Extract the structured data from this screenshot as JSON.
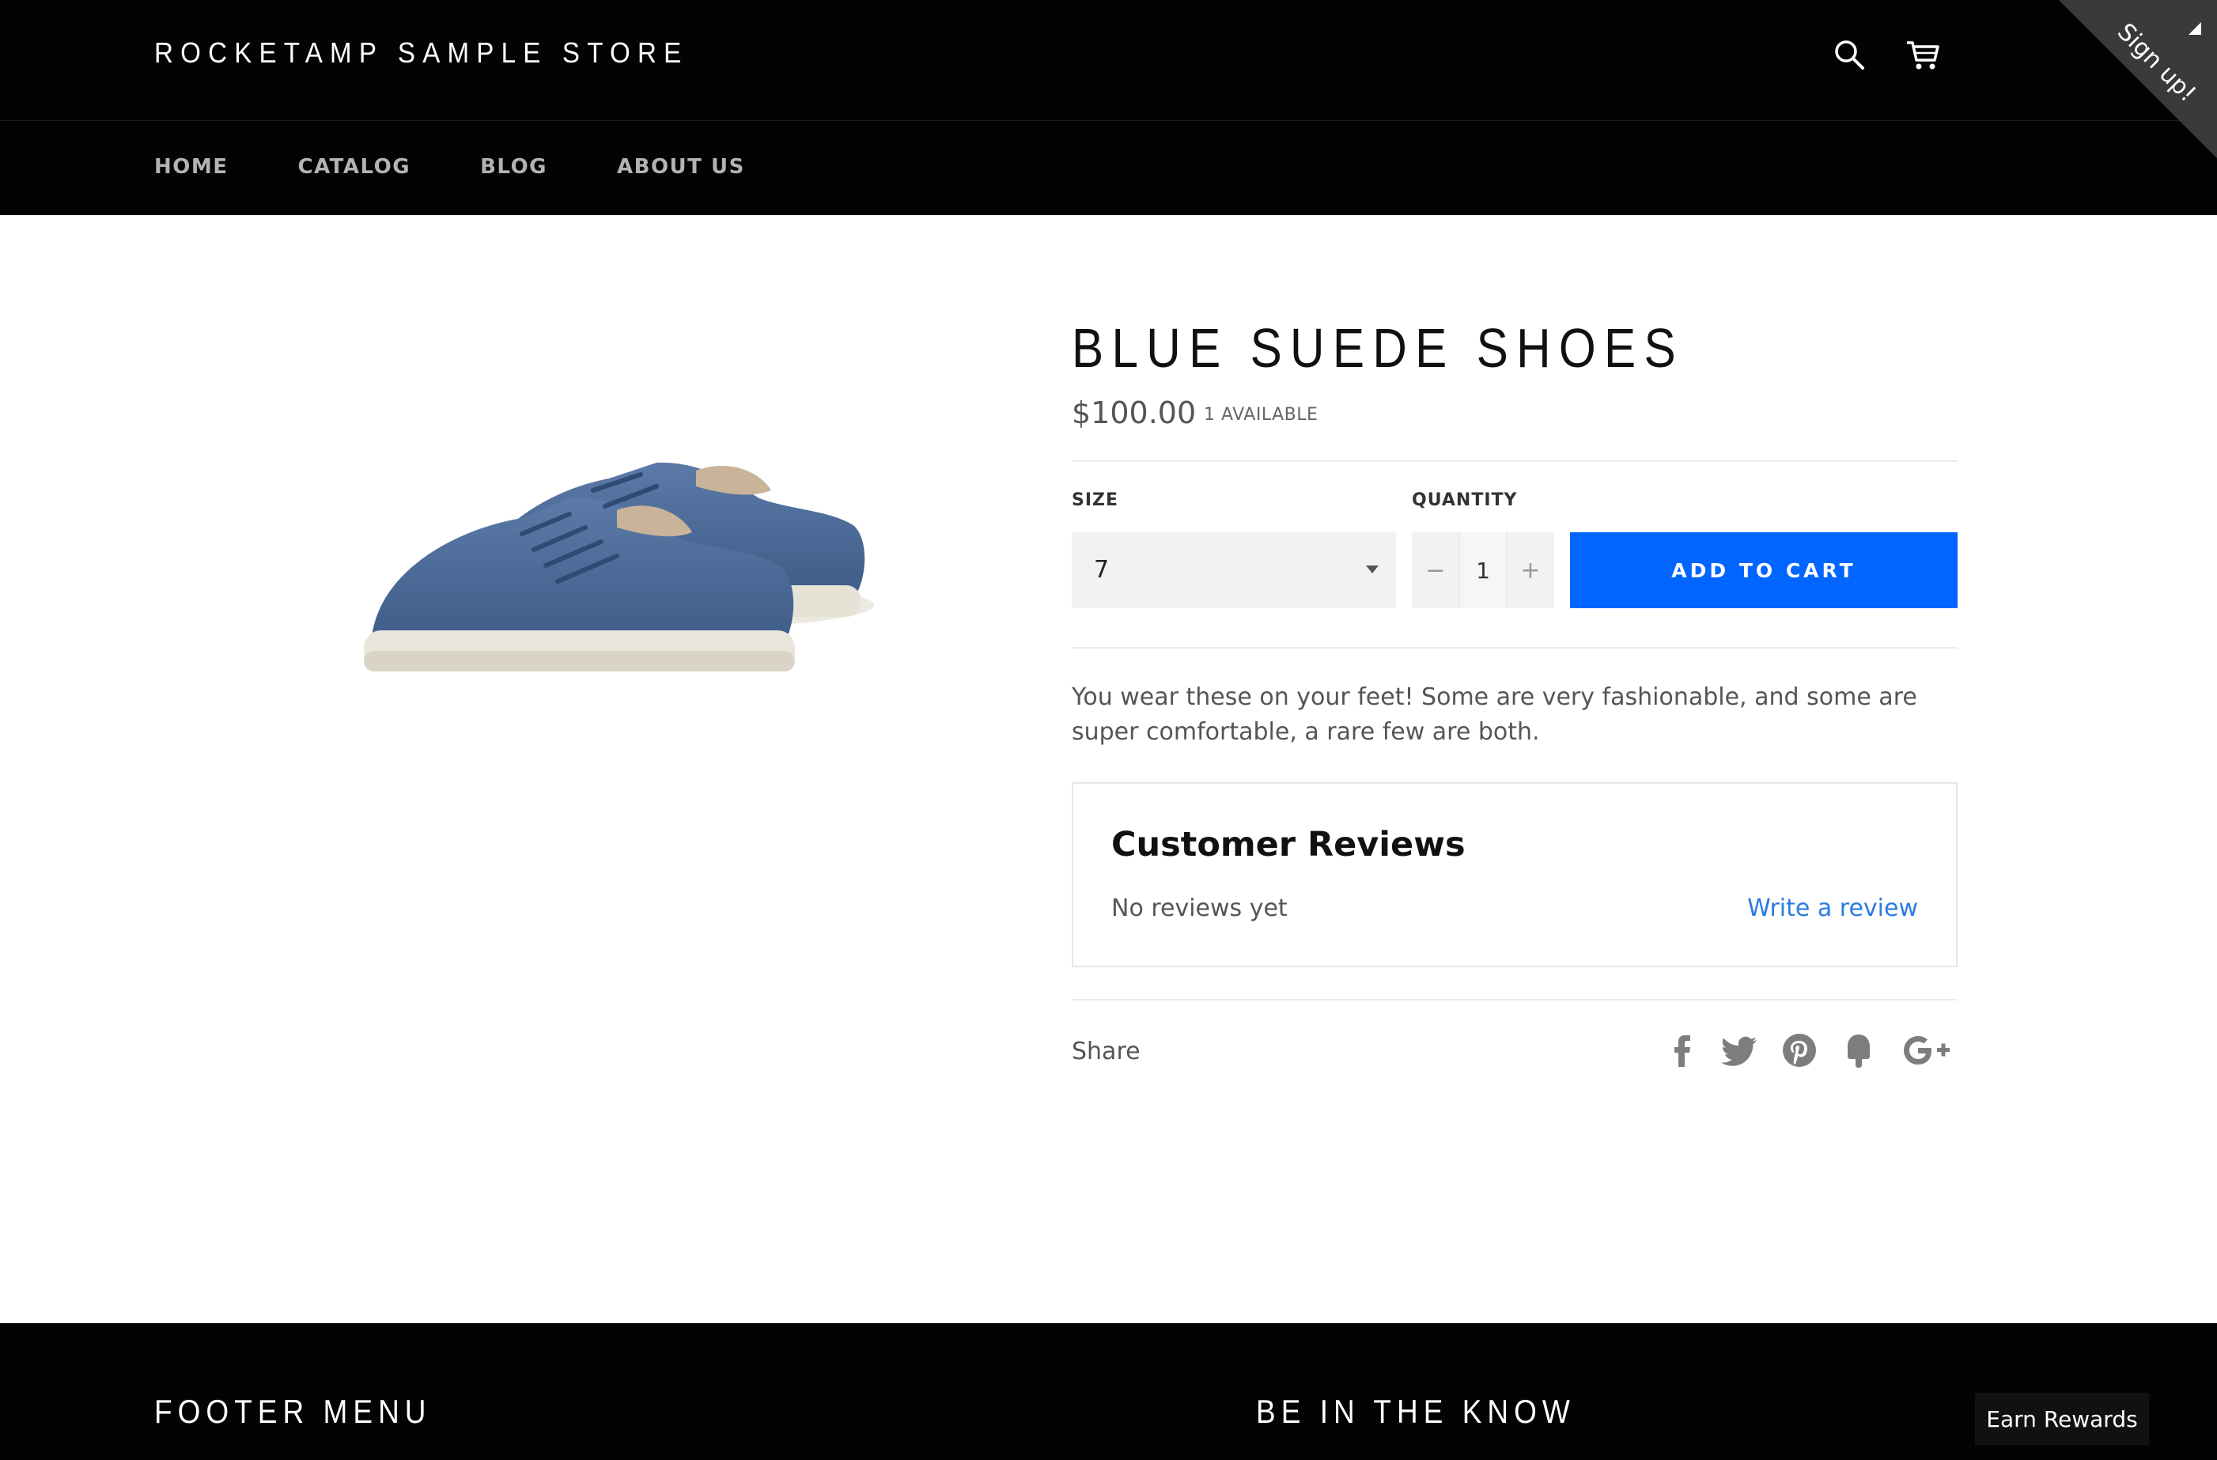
{
  "header": {
    "store_name": "ROCKETAMP SAMPLE STORE",
    "signup_label": "Sign up!",
    "nav": [
      {
        "label": "HOME"
      },
      {
        "label": "CATALOG"
      },
      {
        "label": "BLOG"
      },
      {
        "label": "ABOUT US"
      }
    ]
  },
  "product": {
    "title": "BLUE SUEDE SHOES",
    "price": "$100.00",
    "availability": "1 AVAILABLE",
    "size_label": "SIZE",
    "size_value": "7",
    "quantity_label": "QUANTITY",
    "quantity_value": "1",
    "qty_minus": "−",
    "qty_plus": "+",
    "add_to_cart": "ADD TO CART",
    "description": "You wear these on your feet! Some are very fashionable, and some are super comfortable, a rare few are both."
  },
  "reviews": {
    "title": "Customer Reviews",
    "empty_text": "No reviews yet",
    "write_link": "Write a review"
  },
  "share": {
    "label": "Share",
    "icons": [
      "facebook-icon",
      "twitter-icon",
      "pinterest-icon",
      "fancy-icon",
      "google-plus-icon"
    ]
  },
  "footer": {
    "menu_heading": "FOOTER MENU",
    "newsletter_heading": "BE IN THE KNOW",
    "earn_rewards": "Earn Rewards"
  },
  "colors": {
    "header_bg": "#030303",
    "accent": "#0066ff",
    "link": "#2b7ce0"
  }
}
